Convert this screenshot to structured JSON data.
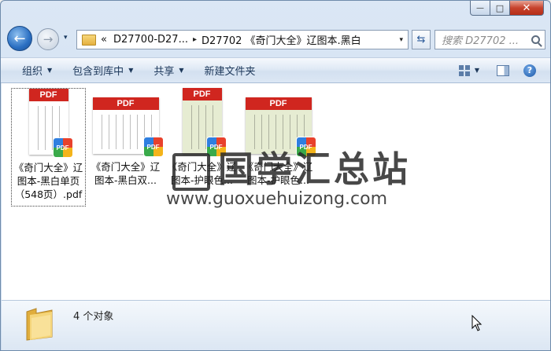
{
  "window": {
    "caption": {
      "minimize": "—",
      "maximize": "□",
      "close": "✕"
    }
  },
  "nav": {
    "back_icon": "arrow-left-icon",
    "forward_icon": "arrow-right-icon",
    "history_dropdown": "▾"
  },
  "address": {
    "overflow": "«",
    "crumbs": [
      "D27700-D27...",
      "D27702 《奇门大全》辽图本.黑白"
    ],
    "separator": "▸",
    "dropdown": "▾"
  },
  "refresh_icon": "⇆",
  "search": {
    "placeholder": "搜索 D27702 ..."
  },
  "toolbar": {
    "organize": "组织",
    "include_library": "包含到库中",
    "share": "共享",
    "new_folder": "新建文件夹",
    "help": "?"
  },
  "files": [
    {
      "name": "《奇门大全》辽图本-黑白单页（548页）.pdf",
      "thumb_label": "PDF",
      "badge": "PDF",
      "paper": "white",
      "selected": true
    },
    {
      "name": "《奇门大全》辽图本-黑白双...",
      "thumb_label": "PDF",
      "badge": "PDF",
      "paper": "white",
      "selected": false
    },
    {
      "name": "《奇门大全》辽图本-护眼色...",
      "thumb_label": "PDF",
      "badge": "PDF",
      "paper": "green",
      "selected": false
    },
    {
      "name": "《奇门大全》辽图本-护眼色...",
      "thumb_label": "PDF",
      "badge": "PDF",
      "paper": "green",
      "selected": false
    }
  ],
  "watermark": {
    "title": "国学汇总站",
    "url": "www.guoxuehuizong.com"
  },
  "status": {
    "count_text": "4 个对象"
  },
  "colors": {
    "pdf_band": "#d0261f",
    "eye_care_paper": "#e6ecd2",
    "accent": "#1e395b"
  }
}
